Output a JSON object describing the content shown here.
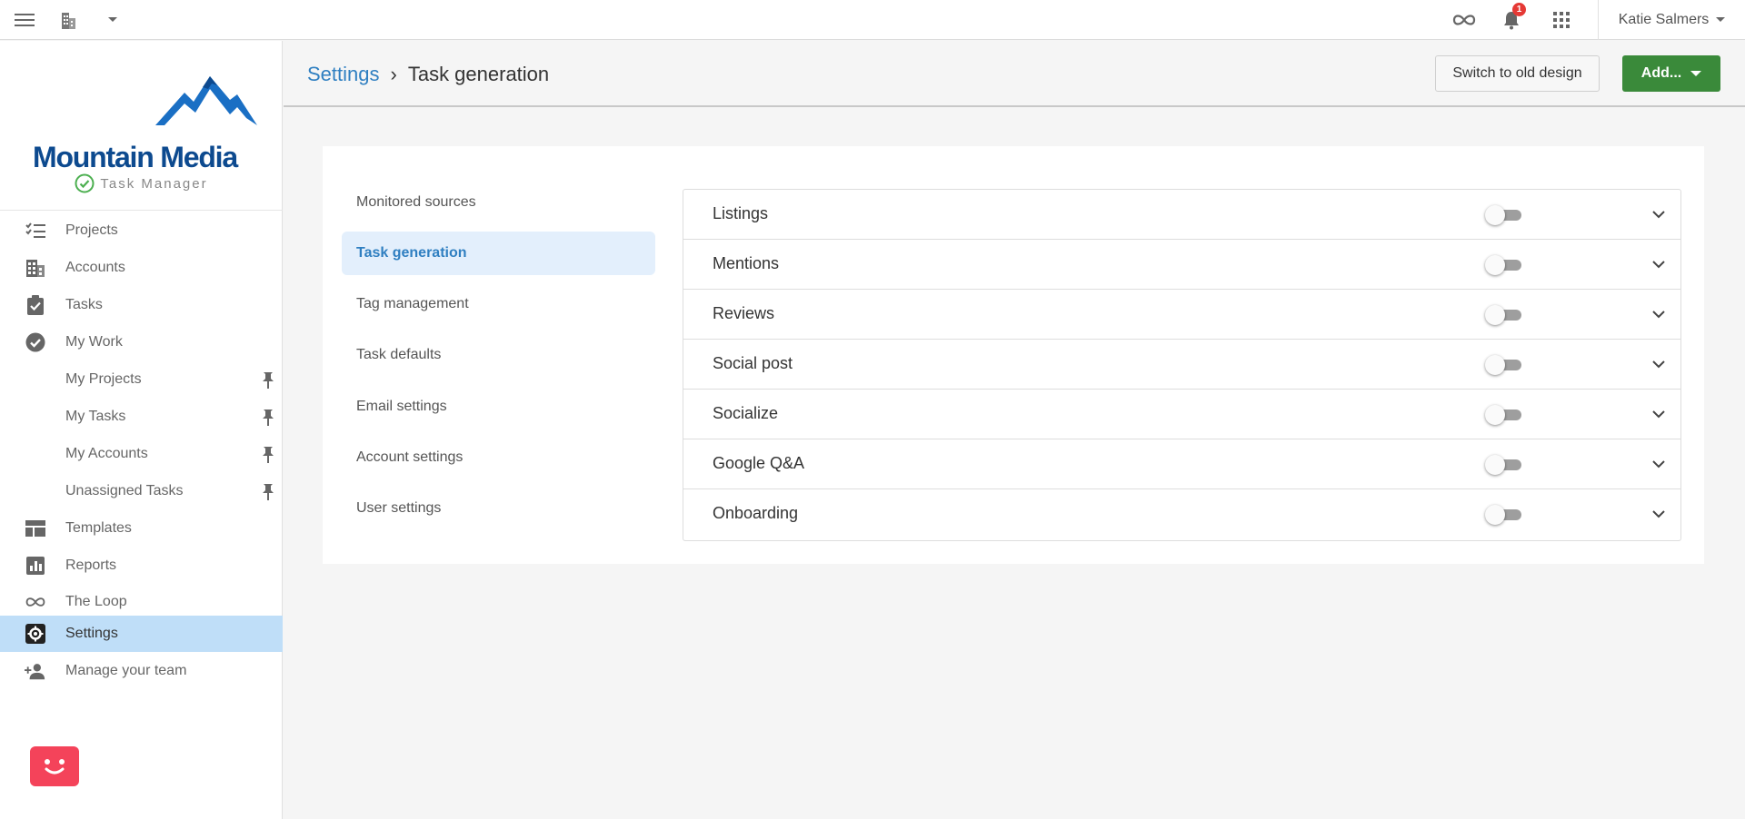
{
  "topbar": {
    "notification_count": "1",
    "user_name": "Katie Salmers"
  },
  "sidebar": {
    "logo_text": "Mountain Media",
    "product_name": "Task Manager",
    "items": [
      {
        "label": "Projects",
        "icon": "checklist-icon"
      },
      {
        "label": "Accounts",
        "icon": "building-icon"
      },
      {
        "label": "Tasks",
        "icon": "clipboard-check-icon"
      },
      {
        "label": "My Work",
        "icon": "check-circle-icon"
      },
      {
        "label": "My Projects",
        "pinned": true
      },
      {
        "label": "My Tasks",
        "pinned": true
      },
      {
        "label": "My Accounts",
        "pinned": true
      },
      {
        "label": "Unassigned Tasks",
        "pinned": true
      },
      {
        "label": "Templates",
        "icon": "template-icon"
      },
      {
        "label": "Reports",
        "icon": "bar-chart-icon"
      },
      {
        "label": "The Loop",
        "icon": "infinity-icon"
      },
      {
        "label": "Settings",
        "icon": "gear-icon",
        "active": true
      },
      {
        "label": "Manage your team",
        "icon": "add-person-icon"
      }
    ]
  },
  "header": {
    "breadcrumb_root": "Settings",
    "breadcrumb_separator": "›",
    "breadcrumb_current": "Task generation",
    "switch_old_label": "Switch to old design",
    "add_label": "Add..."
  },
  "settings_menu": [
    {
      "label": "Monitored sources"
    },
    {
      "label": "Task generation",
      "active": true
    },
    {
      "label": "Tag management"
    },
    {
      "label": "Task defaults"
    },
    {
      "label": "Email settings"
    },
    {
      "label": "Account settings"
    },
    {
      "label": "User settings"
    }
  ],
  "task_types": [
    {
      "label": "Listings",
      "enabled": false
    },
    {
      "label": "Mentions",
      "enabled": false
    },
    {
      "label": "Reviews",
      "enabled": false
    },
    {
      "label": "Social post",
      "enabled": false
    },
    {
      "label": "Socialize",
      "enabled": false
    },
    {
      "label": "Google Q&A",
      "enabled": false
    },
    {
      "label": "Onboarding",
      "enabled": false
    }
  ],
  "colors": {
    "accent": "#2f7fc1",
    "add_button": "#3a8a3a",
    "active_nav": "#bfdef8",
    "active_menu": "#e3effc",
    "badge": "#e53935",
    "chat": "#f4435a"
  }
}
